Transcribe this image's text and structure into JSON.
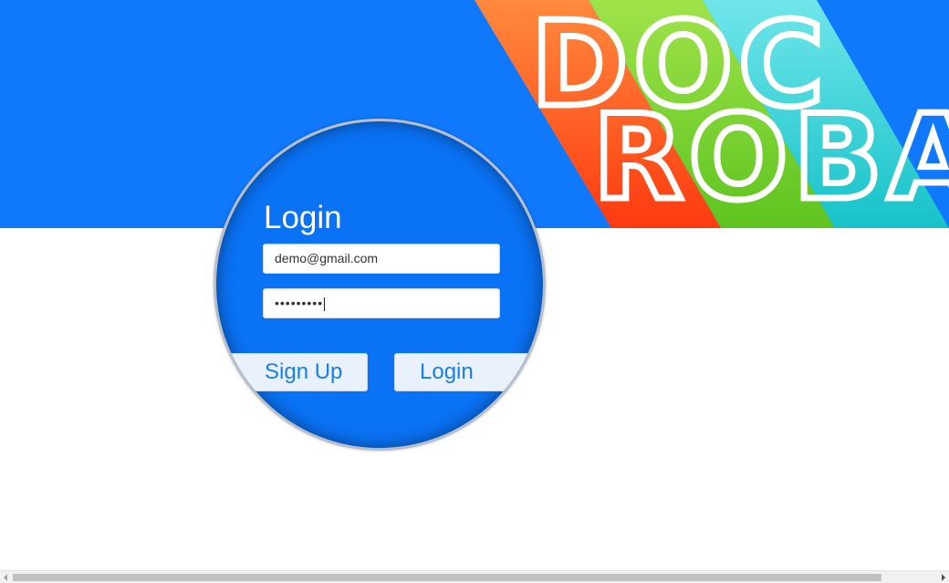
{
  "colors": {
    "banner": "#0f78fb",
    "lens": "#0a72f4",
    "stripe_orange": "#ff5a1f",
    "stripe_green": "#7ad12e",
    "stripe_teal": "#2ed1d6",
    "button_text": "#1a7ef0"
  },
  "logo": {
    "line1": [
      "D",
      "O",
      "C"
    ],
    "line2": [
      "R",
      "O",
      "B",
      "A"
    ]
  },
  "login_form": {
    "title": "Login",
    "email_value": "demo@gmail.com",
    "password_masked": "•••••••••",
    "signup_label": "Sign Up",
    "login_label": "Login"
  },
  "scrollbar": {
    "left_arrow_icon": "triangle-left",
    "right_arrow_icon": "triangle-right"
  }
}
